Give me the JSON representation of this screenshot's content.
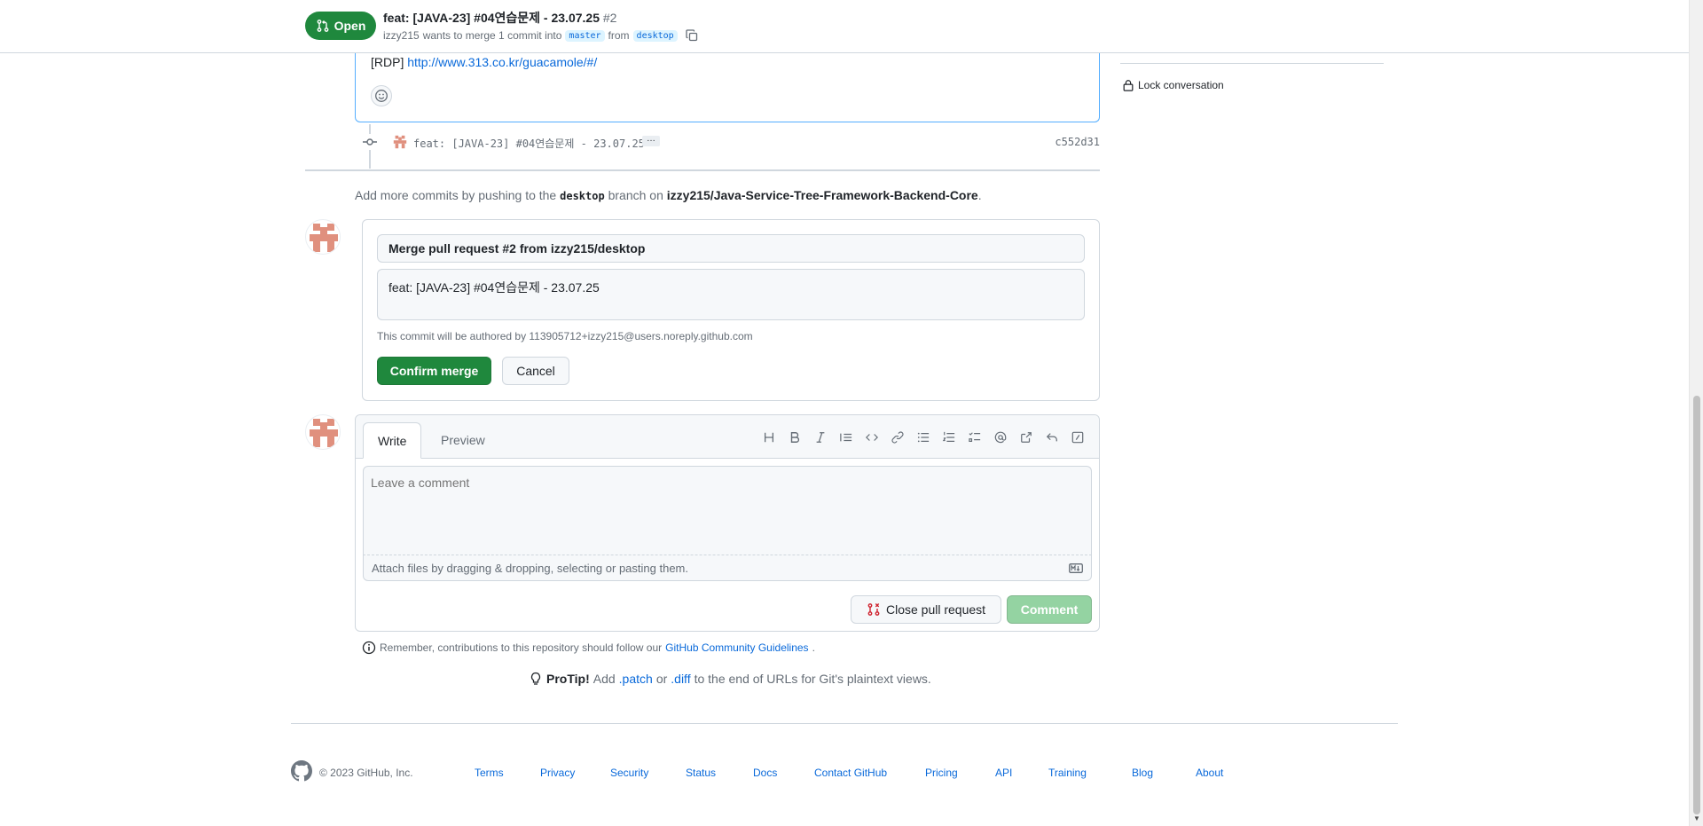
{
  "header": {
    "state_label": "Open",
    "title": "feat: [JAVA-23] #04연습문제 - 23.07.25",
    "number": "#2",
    "author": "izzy215",
    "merge_text": "wants to merge 1 commit into",
    "base_branch": "master",
    "from_text": "from",
    "head_branch": "desktop"
  },
  "prev_comment": {
    "rdp_prefix": "[RDP]",
    "rdp_link": "http://www.313.co.kr/guacamole/#/"
  },
  "commit": {
    "message": "feat: [JAVA-23] #04연습문제 - 23.07.25",
    "ellipsis": "…",
    "sha": "c552d31"
  },
  "push_hint": {
    "prefix": "Add more commits by pushing to the",
    "branch": "desktop",
    "middle": "branch on",
    "repo": "izzy215/Java-Service-Tree-Framework-Backend-Core",
    "suffix": "."
  },
  "merge": {
    "title_value": "Merge pull request #2 from izzy215/desktop",
    "body_value": "feat: [JAVA-23] #04연습문제 - 23.07.25",
    "author_note": "This commit will be authored by 113905712+izzy215@users.noreply.github.com",
    "confirm_label": "Confirm merge",
    "cancel_label": "Cancel"
  },
  "composer": {
    "tab_write": "Write",
    "tab_preview": "Preview",
    "placeholder": "Leave a comment",
    "attach_text": "Attach files by dragging & dropping, selecting or pasting them.",
    "close_pr_label": "Close pull request",
    "comment_label": "Comment"
  },
  "guidelines": {
    "prefix": "Remember, contributions to this repository should follow our",
    "link": "GitHub Community Guidelines",
    "suffix": "."
  },
  "protip": {
    "label": "ProTip!",
    "text1": "Add",
    "patch": ".patch",
    "or": "or",
    "diff": ".diff",
    "text2": "to the end of URLs for Git's plaintext views."
  },
  "sidebar": {
    "lock_label": "Lock conversation"
  },
  "footer": {
    "copyright": "© 2023 GitHub, Inc.",
    "links": [
      "Terms",
      "Privacy",
      "Security",
      "Status",
      "Docs",
      "Contact GitHub",
      "Pricing",
      "API",
      "Training",
      "Blog",
      "About"
    ]
  },
  "colors": {
    "accent": "#0969da",
    "open_green": "#1f883d",
    "comment_disabled": "#94d3a2",
    "avatar": "#e0907e"
  }
}
